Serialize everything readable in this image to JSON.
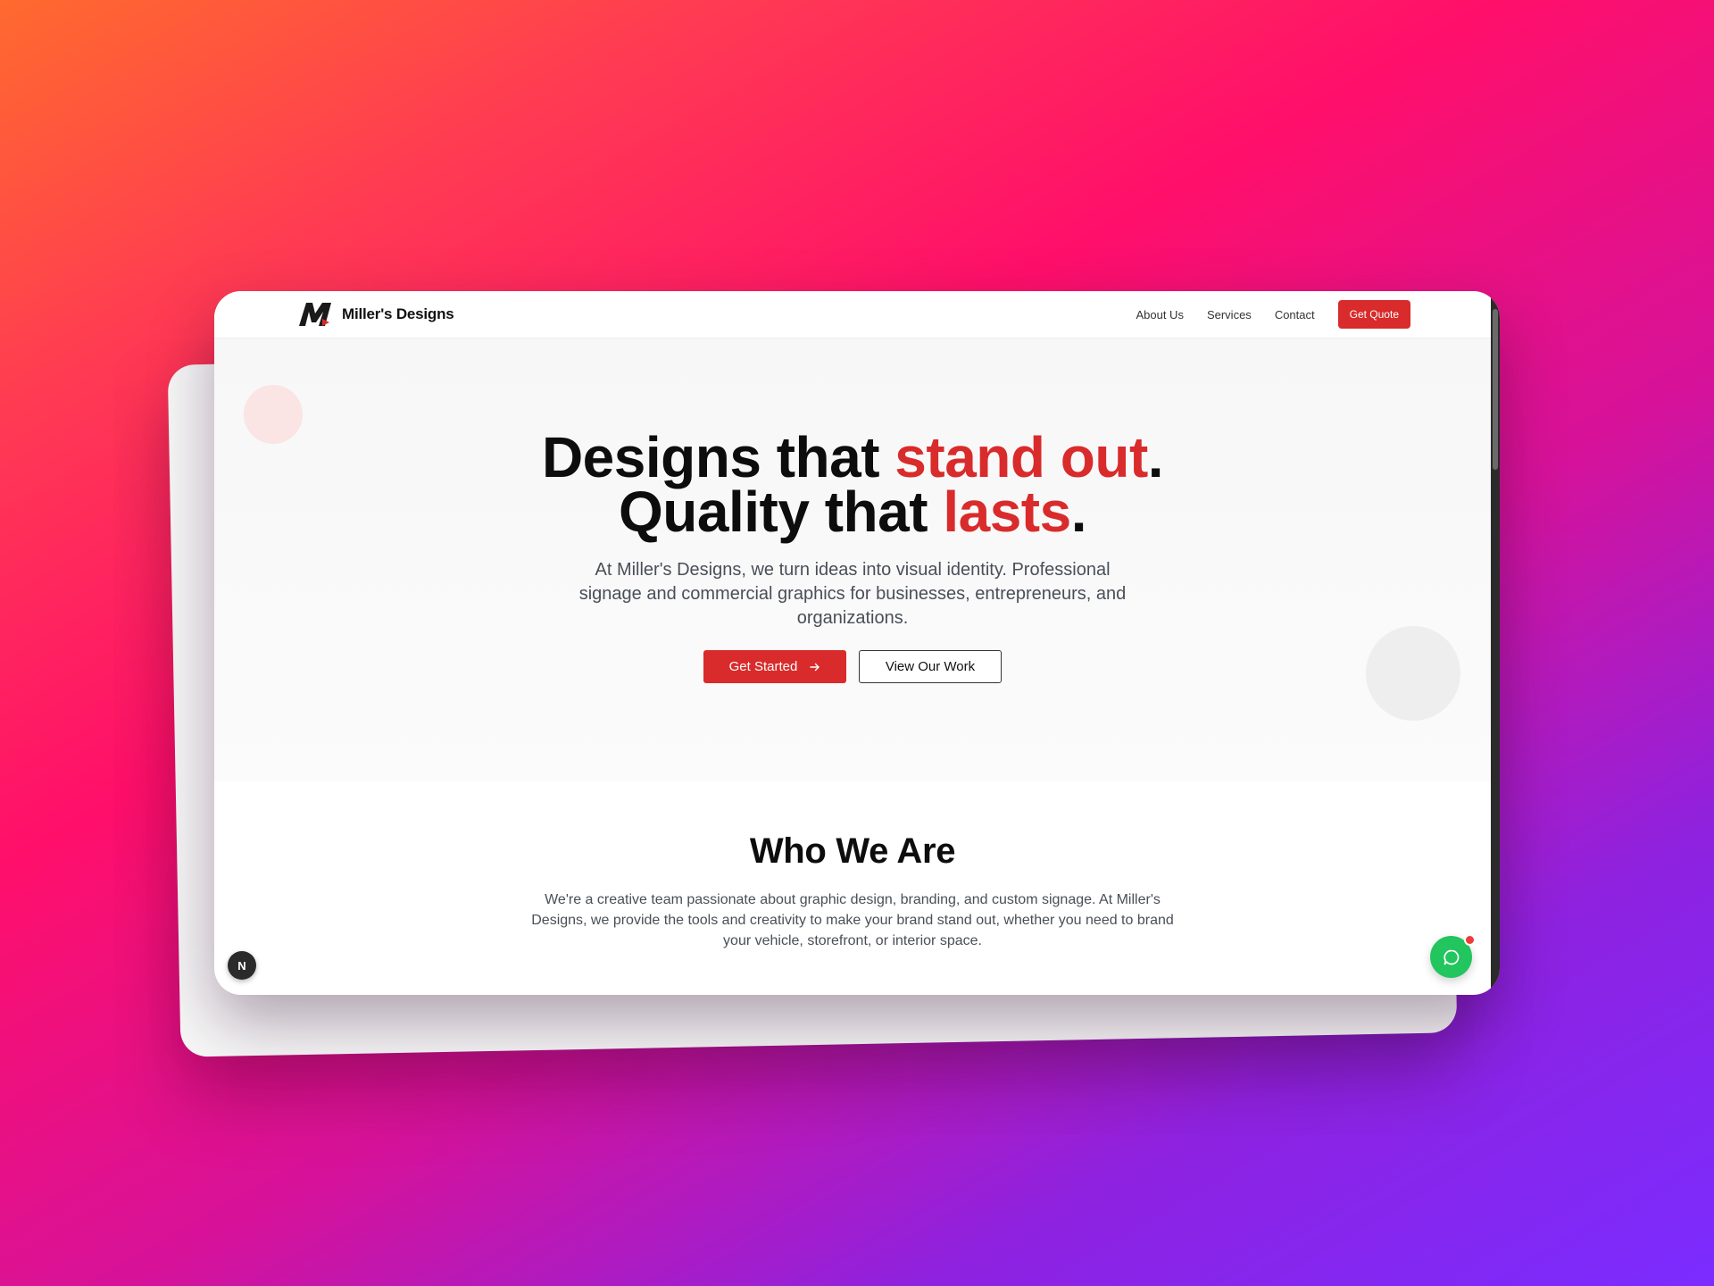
{
  "nav": {
    "brand": "Miller's Designs",
    "links": [
      "About Us",
      "Services",
      "Contact"
    ],
    "cta": "Get Quote"
  },
  "hero": {
    "line1_pre": "Designs that ",
    "line1_accent": "stand out",
    "line1_post": ".",
    "line2_pre": "Quality that ",
    "line2_accent": "lasts",
    "line2_post": ".",
    "subtitle": "At Miller's Designs, we turn ideas into visual identity. Professional signage and commercial graphics for businesses, entrepreneurs, and organizations.",
    "primary_button": "Get Started",
    "secondary_button": "View Our Work"
  },
  "about": {
    "title": "Who We Are",
    "text": "We're a creative team passionate about graphic design, branding, and custom signage. At Miller's Designs, we provide the tools and creativity to make your brand stand out, whether you need to brand your vehicle, storefront, or interior space."
  },
  "widgets": {
    "n_badge": "N",
    "chat_icon": "chat-bubble-icon"
  },
  "colors": {
    "accent": "#d92b2b",
    "chat": "#22c55e"
  }
}
